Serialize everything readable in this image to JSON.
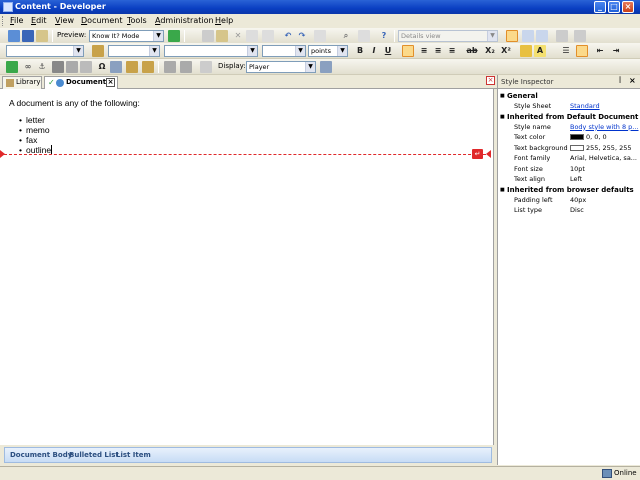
{
  "window": {
    "title": "Content - Developer"
  },
  "menu": [
    "File",
    "Edit",
    "View",
    "Document",
    "Tools",
    "Administration",
    "Help"
  ],
  "toolbar": {
    "preview_label": "Preview:",
    "preview_mode": "Know It? Mode",
    "view_select": "Details view",
    "font_size_unit": "points",
    "display_label": "Display:",
    "display_value": "Player",
    "bold": "B",
    "italic": "I",
    "underline": "U",
    "subscript": "X₂",
    "superscript": "X²",
    "omega": "Ω"
  },
  "tabs": [
    {
      "label": "Library"
    },
    {
      "label": "Document"
    }
  ],
  "document": {
    "intro": "A document is any of the following:",
    "items": [
      "letter",
      "memo",
      "fax",
      "outline"
    ]
  },
  "breadcrumb": [
    "Document Body",
    "Bulleted List",
    "List Item"
  ],
  "inspector": {
    "title": "Style Inspector",
    "sections": [
      {
        "name": "General",
        "props": [
          {
            "key": "Style Sheet",
            "value": "Standard",
            "link": true
          }
        ]
      },
      {
        "name": "Inherited from Default Document Body",
        "props": [
          {
            "key": "Style name",
            "value": "Body style with 8 p...",
            "link": true
          },
          {
            "key": "Text color",
            "value": "0, 0, 0",
            "swatch": "#000000"
          },
          {
            "key": "Text background c...",
            "value": "255, 255, 255",
            "swatch": "#ffffff"
          },
          {
            "key": "Font family",
            "value": "Arial, Helvetica, sa..."
          },
          {
            "key": "Font size",
            "value": "10pt"
          },
          {
            "key": "Text align",
            "value": "Left"
          }
        ]
      },
      {
        "name": "Inherited from browser defaults",
        "props": [
          {
            "key": "Padding left",
            "value": "40px"
          },
          {
            "key": "List type",
            "value": "Disc"
          }
        ]
      }
    ]
  },
  "status": {
    "text": "Online"
  },
  "colors": {
    "marker": "#e0282a",
    "link": "#0033cc",
    "active_button": "#fbd98a"
  }
}
